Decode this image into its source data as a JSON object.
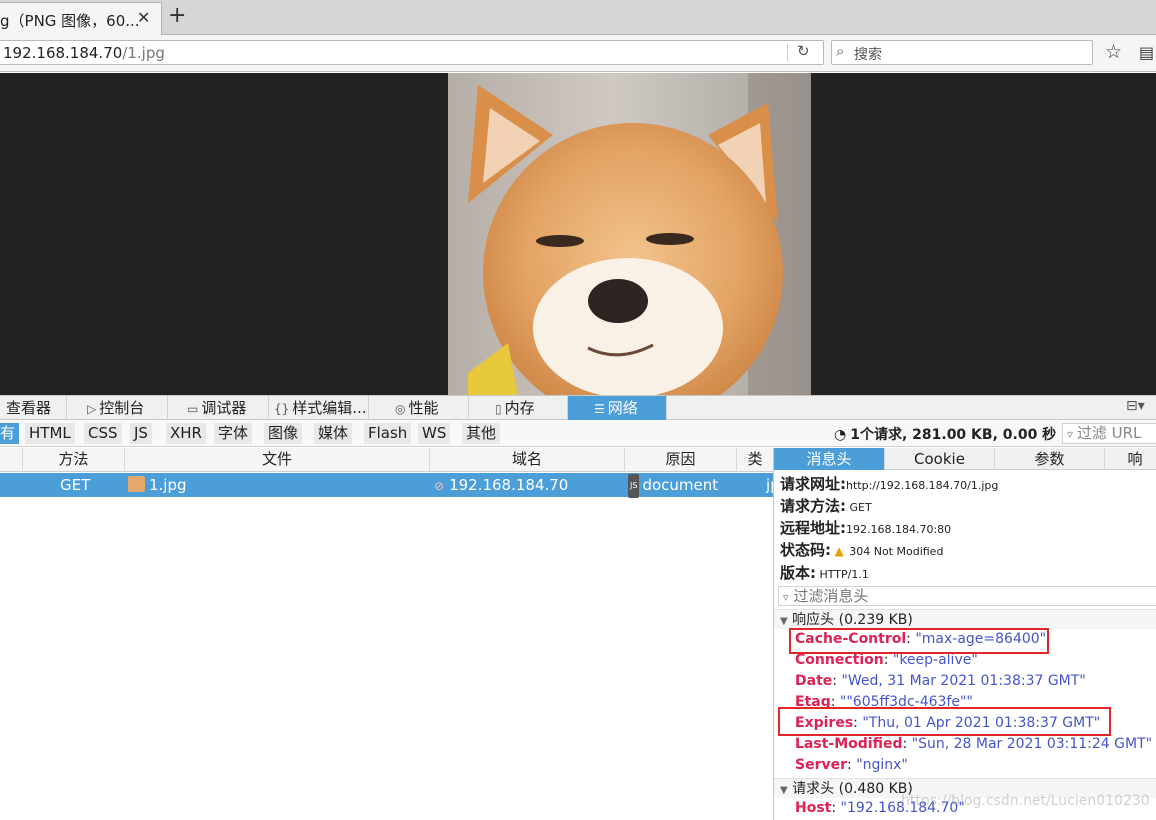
{
  "browser": {
    "tab_title": "g（PNG 图像，60...",
    "new_tab_symbol": "+",
    "url_host": "192.168.184.70",
    "url_path": "/1.jpg",
    "search_placeholder": "搜索"
  },
  "devtools": {
    "tabs": [
      "查看器",
      "控制台",
      "调试器",
      "样式编辑...",
      "性能",
      "内存",
      "网络"
    ],
    "active_tab": "网络",
    "filters": [
      "有",
      "HTML",
      "CSS",
      "JS",
      "XHR",
      "字体",
      "图像",
      "媒体",
      "Flash",
      "WS",
      "其他"
    ],
    "summary": "1个请求, 281.00 KB, 0.00 秒",
    "filter_url_placeholder": "过滤 URL",
    "columns": [
      "方法",
      "文件",
      "域名",
      "原因",
      "类"
    ],
    "request": {
      "method": "GET",
      "file": "1.jpg",
      "domain": "192.168.184.70",
      "cause": "document",
      "type": "jp"
    },
    "detail_tabs": [
      "消息头",
      "Cookie",
      "参数",
      "响"
    ],
    "request_url_label": "请求网址:",
    "request_url": "http://192.168.184.70/1.jpg",
    "method_label": "请求方法:",
    "method": "GET",
    "remote_label": "远程地址:",
    "remote": "192.168.184.70:80",
    "status_label": "状态码:",
    "status": "304  Not  Modified",
    "version_label": "版本:",
    "version": "HTTP/1.1",
    "filter_headers_placeholder": "过滤消息头",
    "response_section": "响应头 (0.239 KB)",
    "response_headers": [
      {
        "key": "Cache-Control",
        "value": "\"max-age=86400\""
      },
      {
        "key": "Connection",
        "value": "\"keep-alive\""
      },
      {
        "key": "Date",
        "value": "\"Wed, 31 Mar 2021 01:38:37 GMT\""
      },
      {
        "key": "Etag",
        "value": "\"\"605ff3dc-463fe\"\""
      },
      {
        "key": "Expires",
        "value": "\"Thu, 01 Apr 2021 01:38:37 GMT\""
      },
      {
        "key": "Last-Modified",
        "value": "\"Sun, 28 Mar 2021 03:11:24 GMT\""
      },
      {
        "key": "Server",
        "value": "\"nginx\""
      }
    ],
    "request_section": "请求头 (0.480 KB)",
    "request_headers": [
      {
        "key": "Host",
        "value": "\"192.168.184.70\""
      }
    ],
    "watermark": "https://blog.csdn.net/Lucien010230"
  },
  "colors": {
    "accent": "#4c9ed9",
    "header_key": "#dd2255",
    "header_value": "#4455cc",
    "highlight_box": "#e0262a",
    "viewer_bg": "#222222"
  }
}
